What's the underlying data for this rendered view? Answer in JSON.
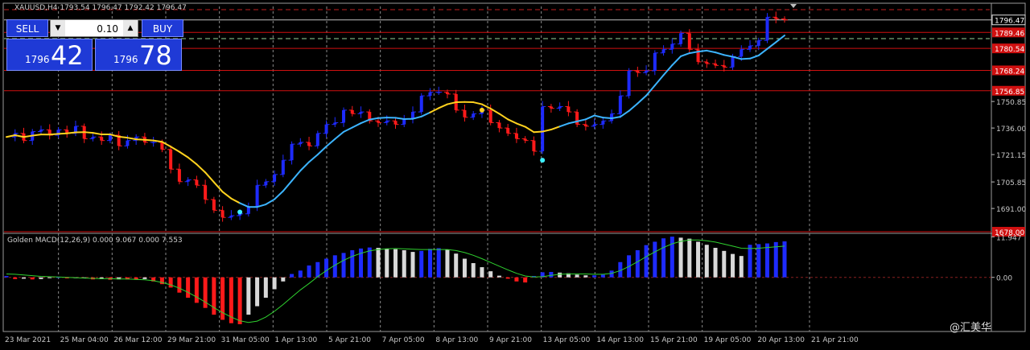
{
  "window": {
    "title": "XAUUSD,H4  1793.54 1796.47 1792.42 1796.47",
    "small_label": "Golden MACD(12,26,9) 0.000 9.067 0.000 7.553"
  },
  "trade_panel": {
    "sell_label": "SELL",
    "buy_label": "BUY",
    "lot_value": "0.10",
    "sell_price_small": "1796",
    "sell_price_big": "42",
    "buy_price_small": "1796",
    "buy_price_big": "78"
  },
  "watermark": "@汇美华",
  "colors": {
    "bull": "#1e2bff",
    "bear": "#ff1a1a",
    "ma_up": "#3cb4ff",
    "ma_down": "#ffd21e",
    "signal_line": "#2fd22f",
    "level_line": "#d01010",
    "grid": "#8a8a8a"
  },
  "chart_data": [
    {
      "type": "candlestick",
      "symbol": "XAUUSD",
      "timeframe": "H4",
      "ylim": [
        1678.0,
        1804.0
      ],
      "y_ticks": [
        "1750.85",
        "1736.00",
        "1721.15",
        "1705.85",
        "1691.00"
      ],
      "y_tick_values": [
        1750.85,
        1736.0,
        1721.15,
        1705.85,
        1691.0
      ],
      "current_price_label": "1796.47",
      "current_price": 1796.47,
      "levels": [
        {
          "label": "1789.46",
          "value": 1789.46
        },
        {
          "label": "1780.54",
          "value": 1780.54
        },
        {
          "label": "1768.24",
          "value": 1768.24
        },
        {
          "label": "1756.85",
          "value": 1756.85
        },
        {
          "label": "1678.00",
          "value": 1678.0
        }
      ],
      "x_labels": [
        "23 Mar 2021",
        "25 Mar 04:00",
        "26 Mar 12:00",
        "29 Mar 21:00",
        "31 Mar 05:00",
        "1 Apr 13:00",
        "5 Apr 21:00",
        "7 Apr 05:00",
        "8 Apr 13:00",
        "9 Apr 21:00",
        "13 Apr 05:00",
        "14 Apr 13:00",
        "15 Apr 21:00",
        "19 Apr 05:00",
        "20 Apr 13:00",
        "21 Apr 21:00"
      ],
      "close_path": [
        1731,
        1733,
        1729,
        1734,
        1735,
        1732,
        1735,
        1733,
        1737,
        1730,
        1731,
        1729,
        1732,
        1726,
        1729,
        1731,
        1728,
        1728,
        1724,
        1713,
        1706,
        1707,
        1704,
        1696,
        1690,
        1686,
        1687,
        1688,
        1692,
        1704,
        1706,
        1710,
        1718,
        1727,
        1728,
        1726,
        1733,
        1738,
        1739,
        1746,
        1744,
        1745,
        1740,
        1739,
        1740,
        1738,
        1741,
        1745,
        1754,
        1756,
        1756,
        1755,
        1746,
        1742,
        1744,
        1746,
        1739,
        1736,
        1733,
        1730,
        1729,
        1723,
        1748,
        1747,
        1748,
        1745,
        1738,
        1737,
        1738,
        1740,
        1744,
        1754,
        1768,
        1767,
        1768,
        1778,
        1780,
        1783,
        1789,
        1780,
        1773,
        1772,
        1771,
        1770,
        1776,
        1780,
        1782,
        1785,
        1798,
        1797,
        1796.47
      ],
      "ma_color_down_ranges": [
        [
          0,
          28
        ],
        [
          50,
          65
        ]
      ],
      "signals": [
        {
          "kind": "buy-dot",
          "index": 27,
          "price": 1689,
          "color": "#3cf0ff"
        },
        {
          "kind": "sell-dot",
          "index": 55,
          "price": 1746,
          "color": "#ffd21e"
        },
        {
          "kind": "buy-dot",
          "index": 62,
          "price": 1718,
          "color": "#3cf0ff"
        }
      ]
    },
    {
      "type": "histogram+line",
      "name": "Golden MACD(12,26,9)",
      "y_ticks": [
        "11.947",
        "0.00"
      ],
      "y_tick_values": [
        11.947,
        0.0
      ],
      "ylim": [
        -15,
        12.5
      ],
      "histogram": [
        0.4,
        -0.5,
        -0.4,
        -0.6,
        -0.5,
        -0.2,
        0.1,
        -0.3,
        -0.2,
        -0.1,
        -0.6,
        -0.5,
        -0.7,
        -0.6,
        -0.6,
        -0.7,
        -0.5,
        -1.2,
        -2.0,
        -3.0,
        -4.5,
        -6.0,
        -7.5,
        -9.0,
        -11.0,
        -12.5,
        -13.5,
        -13.8,
        -11.0,
        -8.5,
        -6.0,
        -3.5,
        -1.2,
        1.0,
        2.0,
        3.5,
        4.5,
        5.5,
        6.5,
        7.2,
        8.0,
        8.5,
        8.8,
        8.7,
        8.5,
        8.3,
        8.0,
        7.5,
        7.8,
        8.4,
        8.6,
        8.2,
        7.0,
        5.5,
        4.2,
        3.0,
        1.8,
        0.5,
        -0.4,
        -1.2,
        -1.5,
        0.4,
        1.5,
        1.6,
        1.4,
        1.2,
        0.8,
        0.6,
        0.6,
        0.8,
        2.0,
        4.5,
        6.5,
        8.0,
        9.5,
        10.5,
        11.5,
        12.0,
        11.7,
        11.4,
        10.5,
        9.6,
        8.7,
        7.8,
        6.9,
        6.3,
        9.6,
        9.8,
        10.0,
        10.4,
        10.6
      ],
      "signal_line": [
        1.0,
        0.9,
        0.7,
        0.5,
        0.3,
        0.2,
        0.1,
        0.0,
        -0.1,
        -0.2,
        -0.3,
        -0.4,
        -0.4,
        -0.5,
        -0.5,
        -0.6,
        -0.7,
        -1.0,
        -1.5,
        -2.2,
        -3.2,
        -4.4,
        -5.8,
        -7.3,
        -8.9,
        -10.4,
        -11.7,
        -12.8,
        -13.3,
        -12.9,
        -11.7,
        -10.0,
        -8.0,
        -5.8,
        -3.7,
        -1.8,
        0.2,
        2.0,
        3.6,
        5.0,
        6.2,
        7.1,
        7.8,
        8.2,
        8.4,
        8.5,
        8.4,
        8.3,
        8.2,
        8.2,
        8.2,
        8.2,
        7.9,
        7.3,
        6.5,
        5.5,
        4.4,
        3.3,
        2.2,
        1.2,
        0.4,
        0.1,
        0.2,
        0.6,
        0.9,
        1.0,
        1.0,
        1.0,
        0.9,
        0.9,
        1.2,
        2.0,
        3.2,
        4.6,
        6.1,
        7.5,
        8.8,
        9.9,
        10.6,
        11.0,
        11.0,
        10.8,
        10.4,
        9.8,
        9.2,
        8.6,
        8.5,
        8.6,
        8.8,
        9.0,
        9.2
      ]
    }
  ]
}
